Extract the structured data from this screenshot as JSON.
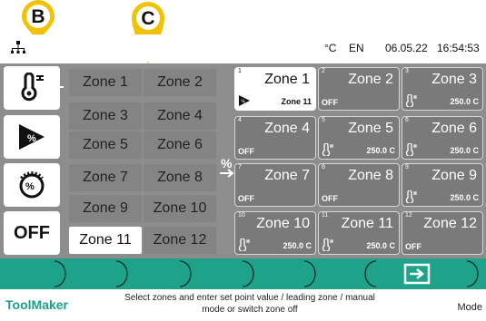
{
  "status": {
    "unit": "°C",
    "language": "EN",
    "date": "06.05.22",
    "time": "16:54:53"
  },
  "callouts": [
    "B",
    "C"
  ],
  "modes": {
    "off_label": "OFF",
    "selected": "setpoint"
  },
  "zone_selector": [
    [
      "Zone 1",
      "Zone 2"
    ],
    [
      "Zone 3",
      "Zone 4"
    ],
    [
      "Zone 5",
      "Zone 6"
    ],
    [
      "Zone 7",
      "Zone 8"
    ],
    [
      "Zone 9",
      "Zone 10"
    ],
    [
      "Zone 11",
      "Zone 12"
    ]
  ],
  "percent_marker": "%",
  "tiles": [
    {
      "num": "1",
      "name": "Zone 1",
      "status": "",
      "value": "Zone 11",
      "selected": true,
      "icon": "play"
    },
    {
      "num": "2",
      "name": "Zone 2",
      "status": "OFF",
      "value": "",
      "selected": false,
      "icon": ""
    },
    {
      "num": "3",
      "name": "Zone 3",
      "status": "",
      "value": "250.0 C",
      "selected": false,
      "icon": "thermo"
    },
    {
      "num": "4",
      "name": "Zone 4",
      "status": "OFF",
      "value": "",
      "selected": false,
      "icon": ""
    },
    {
      "num": "5",
      "name": "Zone 5",
      "status": "",
      "value": "250.0 C",
      "selected": false,
      "icon": "thermo"
    },
    {
      "num": "6",
      "name": "Zone 6",
      "status": "",
      "value": "250.0 C",
      "selected": false,
      "icon": "thermo"
    },
    {
      "num": "7",
      "name": "Zone 7",
      "status": "OFF",
      "value": "",
      "selected": false,
      "icon": ""
    },
    {
      "num": "8",
      "name": "Zone 8",
      "status": "OFF",
      "value": "",
      "selected": false,
      "icon": ""
    },
    {
      "num": "9",
      "name": "Zone 9",
      "status": "",
      "value": "250.0 C",
      "selected": false,
      "icon": "thermo"
    },
    {
      "num": "10",
      "name": "Zone 10",
      "status": "",
      "value": "250.0 C",
      "selected": false,
      "icon": "thermo"
    },
    {
      "num": "11",
      "name": "Zone 11",
      "status": "",
      "value": "250.0 C",
      "selected": false,
      "icon": "thermo"
    },
    {
      "num": "12",
      "name": "Zone 12",
      "status": "OFF",
      "value": "",
      "selected": false,
      "icon": ""
    }
  ],
  "footer": {
    "brand": "ToolMaker",
    "hint_line1": "Select zones and enter set point value / leading zone / manual",
    "hint_line2": "mode or switch zone off",
    "mode_label": "Mode"
  },
  "colors": {
    "teal": "#1ea38a",
    "callout_yellow": "#f2c200",
    "panel_gray": "#8d8d8d"
  }
}
